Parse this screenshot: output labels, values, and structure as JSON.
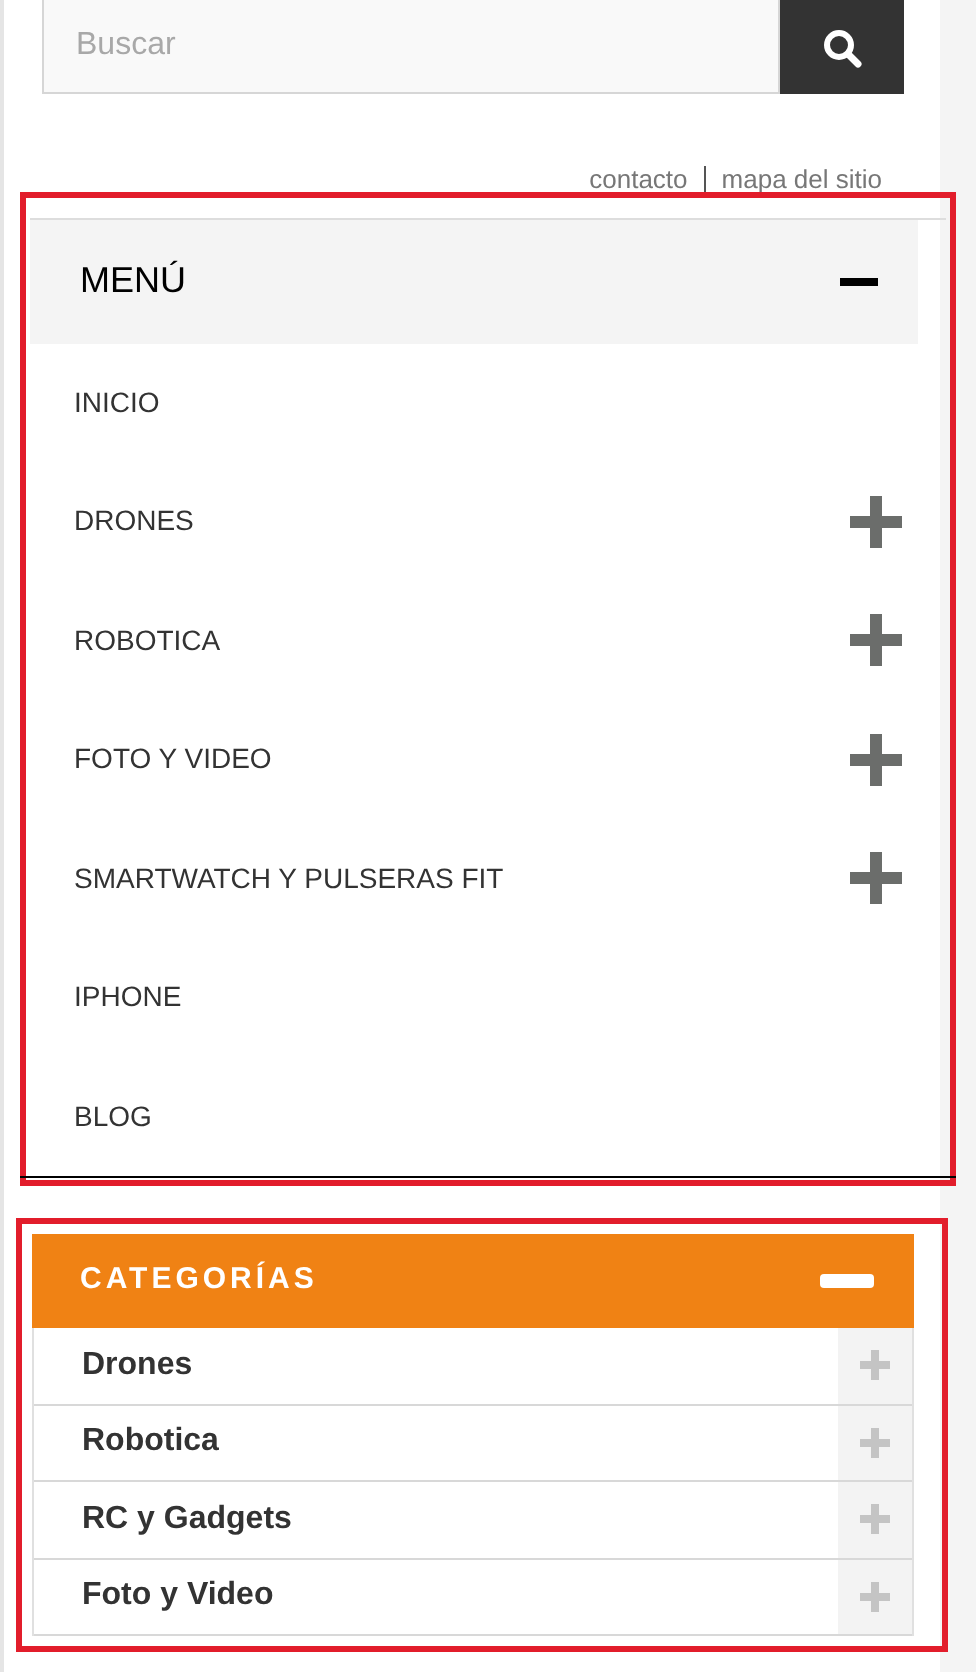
{
  "search": {
    "placeholder": "Buscar"
  },
  "top_links": [
    "contacto",
    "mapa del sitio"
  ],
  "menu": {
    "title": "MENÚ",
    "expanded": true,
    "items": [
      {
        "label": "INICIO",
        "expandable": false
      },
      {
        "label": "DRONES",
        "expandable": true
      },
      {
        "label": "ROBOTICA",
        "expandable": true
      },
      {
        "label": "FOTO Y VIDEO",
        "expandable": true
      },
      {
        "label": "SMARTWATCH Y PULSERAS FIT",
        "expandable": true
      },
      {
        "label": "IPHONE",
        "expandable": false
      },
      {
        "label": "BLOG",
        "expandable": false
      }
    ]
  },
  "categories": {
    "title": "CATEGORÍAS",
    "expanded": true,
    "items": [
      {
        "label": "Drones",
        "expandable": true
      },
      {
        "label": "Robotica",
        "expandable": true
      },
      {
        "label": "RC y Gadgets",
        "expandable": true
      },
      {
        "label": "Foto y Video",
        "expandable": true
      }
    ]
  }
}
